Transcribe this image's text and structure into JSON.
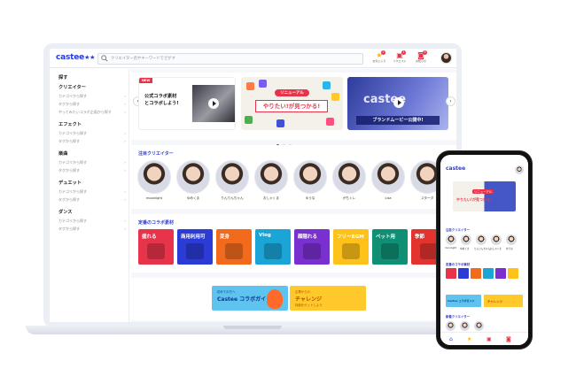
{
  "header": {
    "logo": "castee",
    "search_placeholder": "クリエイター名やキーワードでさがす",
    "icons": [
      {
        "name": "favorite",
        "label": "お気に入り",
        "badge": "2"
      },
      {
        "name": "request",
        "label": "リクエスト",
        "badge": "1"
      },
      {
        "name": "notice",
        "label": "お知らせ",
        "badge": "5"
      }
    ]
  },
  "sidebar": {
    "search_heading": "探す",
    "groups": [
      {
        "title": "クリエイター",
        "items": [
          "カテゴリから探す",
          "タグから探す",
          "やってみたいコラボ企画から探す"
        ]
      },
      {
        "title": "エフェクト",
        "items": [
          "カテゴリから探す",
          "タグから探す"
        ]
      },
      {
        "title": "楽曲",
        "items": [
          "カテゴリから探す",
          "タグから探す"
        ]
      },
      {
        "title": "デュエット",
        "items": [
          "カテゴリから探す",
          "タグから探す"
        ]
      },
      {
        "title": "ダンス",
        "items": [
          "カテゴリから探す",
          "タグから探す"
        ]
      }
    ]
  },
  "carousel": {
    "slide1": {
      "badge": "NEW",
      "line1": "公式コラボ素材",
      "line2": "とコラボしよう!"
    },
    "slide2": {
      "pill": "リニューアル",
      "headline": "やりたい!が見つかる!"
    },
    "slide3": {
      "logo": "castee",
      "caption": "ブランドムービー公開中!"
    }
  },
  "featured_creators": {
    "title": "注目クリエイター",
    "items": [
      "moonlight",
      "ゆめくま",
      "りんりんちゃん",
      "おしゃくま",
      "ゆうな",
      "がちトレ",
      "Lisa",
      "スターダ"
    ]
  },
  "materials": {
    "title": "定番のコラボ素材",
    "items": [
      {
        "label": "盛れる",
        "color": "#e8344a"
      },
      {
        "label": "商用利用可",
        "color": "#2b3bd6"
      },
      {
        "label": "変身",
        "color": "#f26b1d"
      },
      {
        "label": "Vlog",
        "color": "#1aa5d6"
      },
      {
        "label": "顔隠れる",
        "color": "#7a2fd0"
      },
      {
        "label": "フリーBGM",
        "color": "#ffc21a"
      },
      {
        "label": "ペット用",
        "color": "#0f8f73"
      },
      {
        "label": "季節",
        "color": "#e2332f"
      }
    ]
  },
  "promo": {
    "banner1": {
      "top": "初めての方へ",
      "main": "Castee コラボガイド",
      "bottom": ""
    },
    "banner2": {
      "top": "企業からの",
      "main": "チャレンジ",
      "bottom": "特典をゲットしよう"
    }
  },
  "phone": {
    "logo": "castee",
    "section1": "注目クリエイター",
    "section2": "定番のコラボ素材",
    "section3": "新着クリエイター",
    "creators": [
      "moonlight",
      "ゆめくま",
      "りんりんちゃん",
      "おしゃくま",
      "ゆうな"
    ],
    "banner_label": "Castee コラボガイド",
    "banner2_label": "チャレンジ"
  }
}
